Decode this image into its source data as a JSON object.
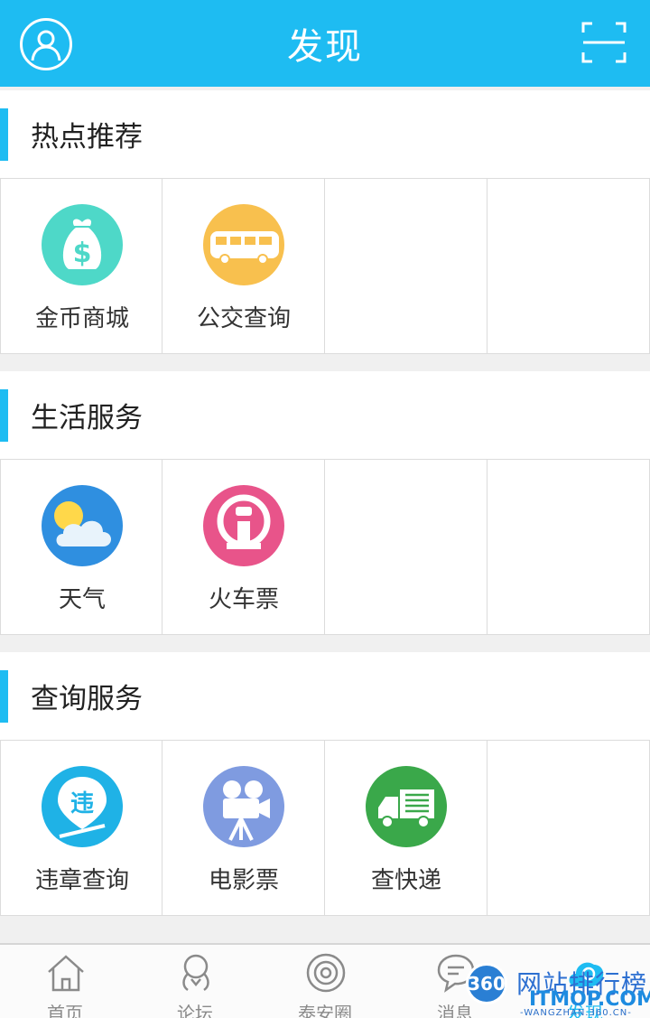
{
  "header": {
    "title": "发现",
    "avatar_icon": "user-avatar-icon",
    "scan_icon": "scan-icon",
    "color": "#1ebcf2"
  },
  "sections": [
    {
      "title": "热点推荐",
      "items": [
        {
          "label": "金币商城",
          "icon": "money-bag-icon",
          "color": "#4ed8c8"
        },
        {
          "label": "公交查询",
          "icon": "bus-icon",
          "color": "#f8c04e"
        }
      ]
    },
    {
      "title": "生活服务",
      "items": [
        {
          "label": "天气",
          "icon": "weather-icon",
          "color": "#2f8fe0"
        },
        {
          "label": "火车票",
          "icon": "train-icon",
          "color": "#e8548a"
        }
      ]
    },
    {
      "title": "查询服务",
      "items": [
        {
          "label": "违章查询",
          "icon": "violation-icon",
          "color": "#1fb2e6"
        },
        {
          "label": "电影票",
          "icon": "movie-camera-icon",
          "color": "#7f9be0"
        },
        {
          "label": "查快递",
          "icon": "delivery-truck-icon",
          "color": "#3aa84a"
        }
      ]
    }
  ],
  "tabbar": {
    "tabs": [
      {
        "label": "首页",
        "icon": "home-icon"
      },
      {
        "label": "论坛",
        "icon": "forum-icon"
      },
      {
        "label": "泰安圈",
        "icon": "circle-icon"
      },
      {
        "label": "消息",
        "icon": "message-icon"
      },
      {
        "label": "发现",
        "icon": "discover-icon",
        "active": true
      }
    ]
  },
  "watermark": {
    "logo": "360",
    "cn": "网站排行榜",
    "en": "ITMOP.COM",
    "url": "-WANGZHAN.360.CN-"
  }
}
